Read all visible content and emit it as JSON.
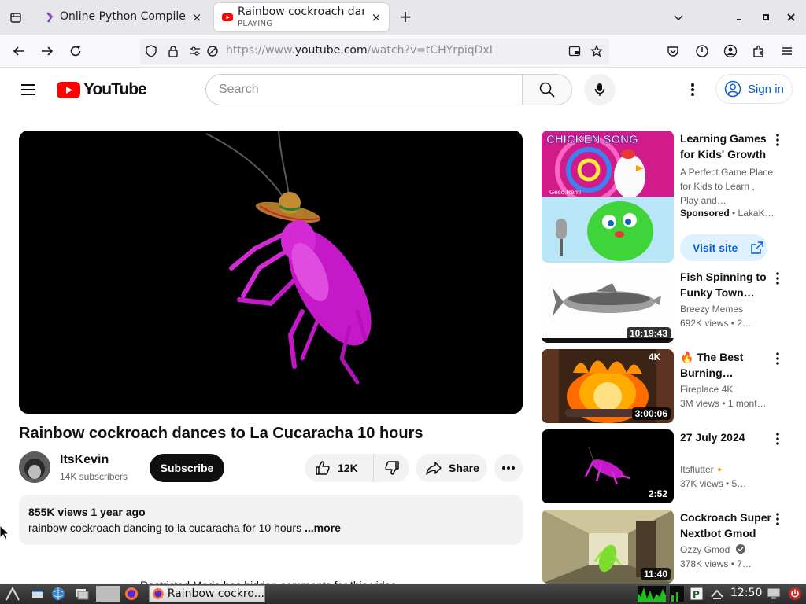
{
  "browser": {
    "tabs": [
      {
        "title": "Online Python Compiler (I",
        "close": "×"
      },
      {
        "title": "Rainbow cockroach danc",
        "subtitle": "PLAYING",
        "close": "×"
      }
    ],
    "new_tab": "+",
    "url_scheme": "https://www.",
    "url_host": "youtube.com",
    "url_path": "/watch?v=tCHYrpiqDxI"
  },
  "header": {
    "logo_text": "YouTube",
    "search_placeholder": "Search",
    "sign_in": "Sign in"
  },
  "video": {
    "title": "Rainbow cockroach dances to La Cucaracha 10 hours",
    "channel": "ItsKevin",
    "subscribers": "14K subscribers",
    "subscribe": "Subscribe",
    "likes": "12K",
    "share": "Share",
    "stats": "855K views  1 year ago",
    "description": "rainbow cockroach dancing to la cucaracha for 10 hours ",
    "more": "...more",
    "restricted": "Restricted Mode has hidden comments for this video."
  },
  "ad": {
    "title": "Learning Games for Kids' Growth",
    "description": "A Perfect Game Place for Kids to Learn , Play and…",
    "sponsored": "Sponsored",
    "advertiser": " • LakaK…",
    "visit": "Visit site",
    "thumb_text": "CHICKEN SONG",
    "thumb_credit": "Geco Remi"
  },
  "recommendations": [
    {
      "title": "Fish Spinning to Funky Town…",
      "channel": "Breezy Memes",
      "meta": "692K views  • 2…",
      "duration": "10:19:43"
    },
    {
      "title": "🔥 The Best Burning…",
      "channel": "Fireplace 4K",
      "meta": "3M views  • 1 mont…",
      "duration": "3:00:06",
      "badge": "4K"
    },
    {
      "title": "27 July 2024",
      "channel": "Itsflutter🔸",
      "meta": "37K views  • 5…",
      "duration": "2:52"
    },
    {
      "title": "Cockroach Super Nextbot Gmod",
      "channel": "Ozzy Gmod",
      "meta": "378K views  • 7…",
      "duration": "11:40"
    }
  ],
  "taskbar": {
    "window_title": "Rainbow cockro...",
    "clock": "12:50"
  }
}
